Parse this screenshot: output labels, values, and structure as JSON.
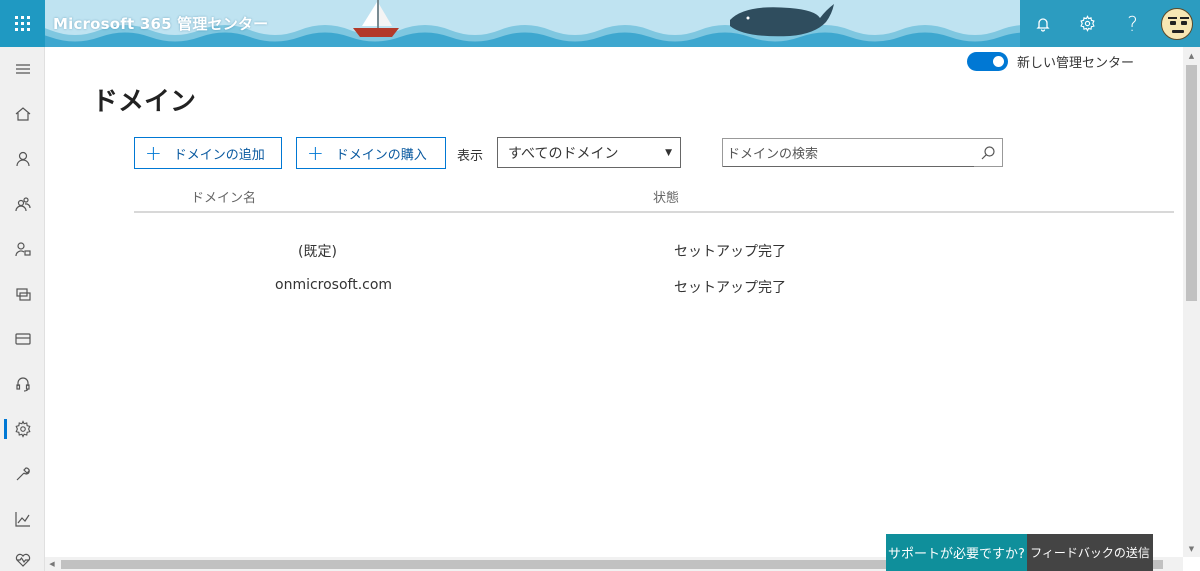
{
  "header": {
    "app_title": "Microsoft 365 管理センター",
    "icons": [
      "waffle-icon",
      "bell-icon",
      "gear-icon",
      "help-icon",
      "avatar"
    ],
    "help_glyph": "?",
    "colors": {
      "sky": "#bfe3f1",
      "header_accent": "#2c9cc0",
      "waffle_bg": "#1f99c2"
    }
  },
  "toggle": {
    "label": "新しい管理センター",
    "on": true
  },
  "page": {
    "title": "ドメイン"
  },
  "toolbar": {
    "add_domain": "ドメインの追加",
    "buy_domain": "ドメインの購入",
    "show_label": "表示",
    "filter_selected": "すべてのドメイン",
    "search_placeholder": "ドメインの検索"
  },
  "table": {
    "columns": [
      "ドメイン名",
      "状態"
    ],
    "rows": [
      {
        "domain": "(既定)",
        "status": "セットアップ完了"
      },
      {
        "domain": "onmicrosoft.com",
        "status": "セットアップ完了"
      }
    ]
  },
  "rail": {
    "items": [
      "menu-icon",
      "home-icon",
      "user-icon",
      "groups-icon",
      "roles-icon",
      "resources-icon",
      "billing-icon",
      "support-icon",
      "settings-icon",
      "setup-icon",
      "reports-icon",
      "health-icon"
    ],
    "active": "settings-icon"
  },
  "footer": {
    "support": "サポートが必要ですか?",
    "feedback": "フィードバックの送信"
  },
  "accent": "#0078d4"
}
